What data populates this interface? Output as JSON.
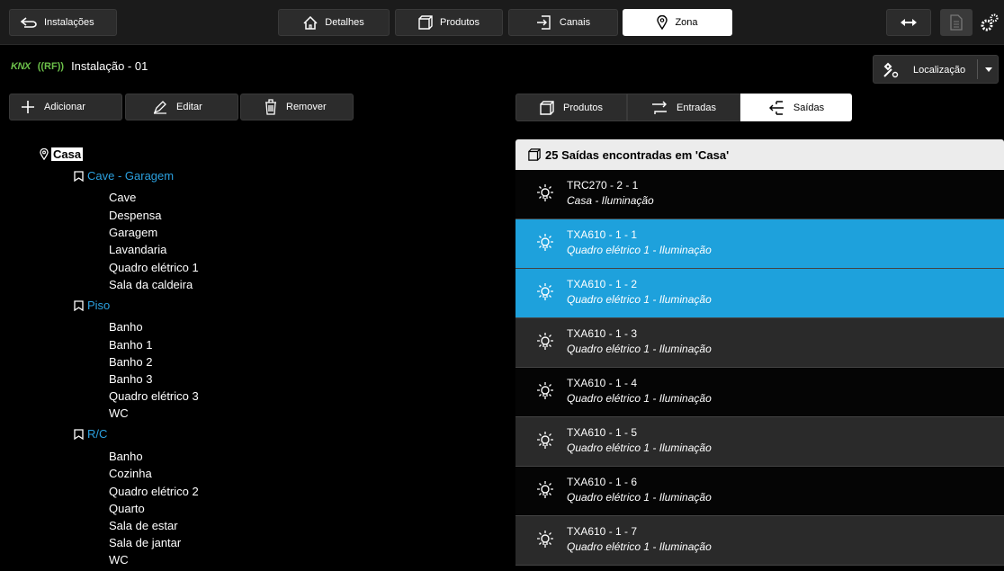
{
  "topbar": {
    "back_label": "Instalações",
    "tabs": [
      {
        "label": "Detalhes"
      },
      {
        "label": "Produtos"
      },
      {
        "label": "Canais"
      },
      {
        "label": "Zona"
      }
    ]
  },
  "header": {
    "knx": "KNX",
    "rf": "((RF))",
    "title": "Instalação - 01",
    "location_label": "Localização"
  },
  "actions": {
    "add": "Adicionar",
    "edit": "Editar",
    "remove": "Remover"
  },
  "tree": {
    "root": "Casa",
    "zones": [
      {
        "label": "Cave - Garagem",
        "items": [
          "Cave",
          "Despensa",
          "Garagem",
          "Lavandaria",
          "Quadro elétrico 1",
          "Sala da caldeira"
        ]
      },
      {
        "label": "Piso",
        "items": [
          "Banho",
          "Banho 1",
          "Banho 2",
          "Banho 3",
          "Quadro elétrico 3",
          "WC"
        ]
      },
      {
        "label": "R/C",
        "items": [
          "Banho",
          "Cozinha",
          "Quadro elétrico 2",
          "Quarto",
          "Sala de estar",
          "Sala de jantar",
          "WC"
        ]
      }
    ]
  },
  "subtabs": [
    {
      "label": "Produtos"
    },
    {
      "label": "Entradas"
    },
    {
      "label": "Saídas"
    }
  ],
  "list": {
    "header": "25 Saídas encontradas em 'Casa'",
    "rows": [
      {
        "name": "TRC270 - 2 - 1",
        "desc": "Casa - Iluminação"
      },
      {
        "name": "TXA610 - 1 - 1",
        "desc": "Quadro elétrico 1 - Iluminação"
      },
      {
        "name": "TXA610 - 1 - 2",
        "desc": "Quadro elétrico 1 - Iluminação"
      },
      {
        "name": "TXA610 - 1 - 3",
        "desc": "Quadro elétrico 1 - Iluminação"
      },
      {
        "name": "TXA610 - 1 - 4",
        "desc": "Quadro elétrico 1 - Iluminação"
      },
      {
        "name": "TXA610 - 1 - 5",
        "desc": "Quadro elétrico 1 - Iluminação"
      },
      {
        "name": "TXA610 - 1 - 6",
        "desc": "Quadro elétrico 1 - Iluminação"
      },
      {
        "name": "TXA610 - 1 - 7",
        "desc": "Quadro elétrico 1 - Iluminação"
      }
    ]
  },
  "colors": {
    "accent": "#1ea1dc",
    "zone": "#2ba0df",
    "knx_green": "#6cc04a"
  }
}
